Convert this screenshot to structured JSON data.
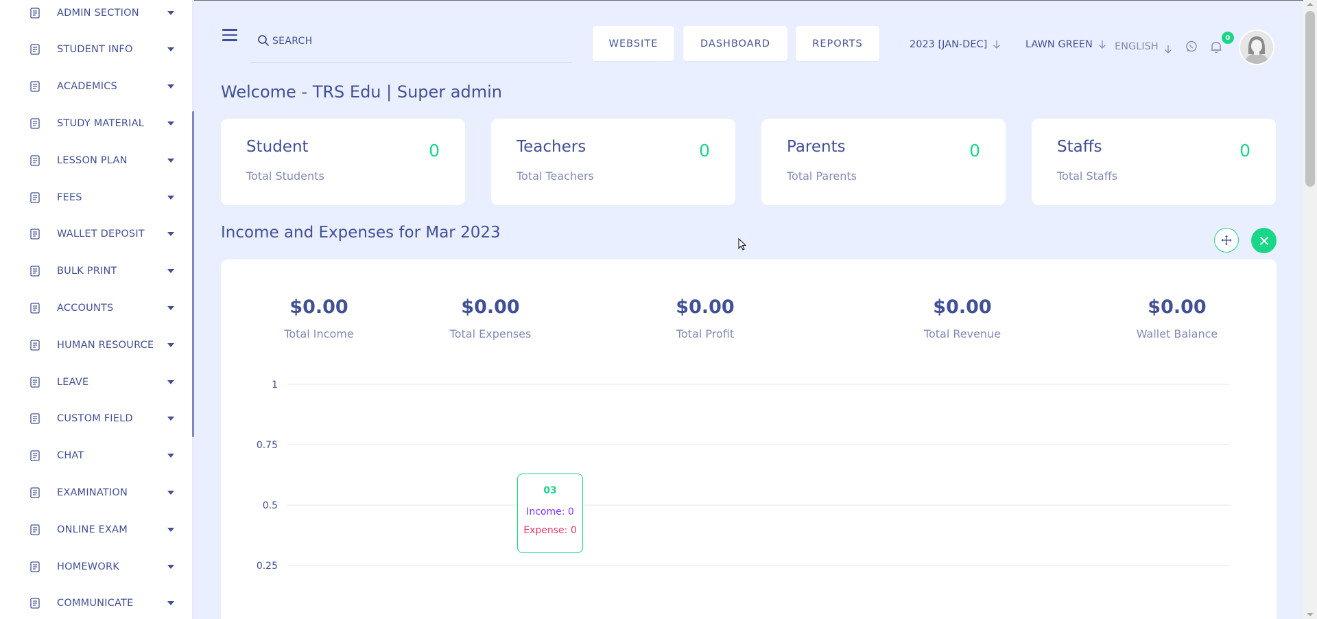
{
  "sidebar": {
    "items": [
      {
        "label": "ADMIN SECTION",
        "icon": "admin-icon"
      },
      {
        "label": "STUDENT INFO",
        "icon": "student-icon"
      },
      {
        "label": "ACADEMICS",
        "icon": "academics-icon"
      },
      {
        "label": "STUDY MATERIAL",
        "icon": "study-material-icon"
      },
      {
        "label": "LESSON PLAN",
        "icon": "lesson-plan-icon"
      },
      {
        "label": "FEES",
        "icon": "fees-icon"
      },
      {
        "label": "WALLET DEPOSIT",
        "icon": "wallet-icon"
      },
      {
        "label": "BULK PRINT",
        "icon": "bulk-print-icon"
      },
      {
        "label": "ACCOUNTS",
        "icon": "accounts-icon"
      },
      {
        "label": "HUMAN RESOURCE",
        "icon": "human-resource-icon"
      },
      {
        "label": "LEAVE",
        "icon": "leave-icon"
      },
      {
        "label": "CUSTOM FIELD",
        "icon": "custom-field-icon"
      },
      {
        "label": "CHAT",
        "icon": "chat-icon"
      },
      {
        "label": "EXAMINATION",
        "icon": "examination-icon"
      },
      {
        "label": "ONLINE EXAM",
        "icon": "online-exam-icon"
      },
      {
        "label": "HOMEWORK",
        "icon": "homework-icon"
      },
      {
        "label": "COMMUNICATE",
        "icon": "communicate-icon"
      }
    ]
  },
  "header": {
    "search_placeholder": "SEARCH",
    "buttons": {
      "website": "WEBSITE",
      "dashboard": "DASHBOARD",
      "reports": "REPORTS"
    },
    "academic_year": "2023 [JAN-DEC]",
    "theme": "LAWN GREEN",
    "language": "ENGLISH",
    "notification_count": "0"
  },
  "welcome": "Welcome - TRS Edu | Super admin",
  "stats": [
    {
      "title": "Student",
      "subtitle": "Total Students",
      "value": "0"
    },
    {
      "title": "Teachers",
      "subtitle": "Total Teachers",
      "value": "0"
    },
    {
      "title": "Parents",
      "subtitle": "Total Parents",
      "value": "0"
    },
    {
      "title": "Staffs",
      "subtitle": "Total Staffs",
      "value": "0"
    }
  ],
  "income_section": {
    "title": "Income and Expenses for Mar 2023",
    "summary": [
      {
        "value": "$0.00",
        "label": "Total Income"
      },
      {
        "value": "$0.00",
        "label": "Total Expenses"
      },
      {
        "value": "$0.00",
        "label": "Total Profit"
      },
      {
        "value": "$0.00",
        "label": "Total Revenue"
      },
      {
        "value": "$0.00",
        "label": "Wallet Balance"
      }
    ],
    "tooltip": {
      "label": "03",
      "income": "Income: 0",
      "expense": "Expense: 0"
    }
  },
  "colors": {
    "primary": "#415094",
    "accent": "#1ad788",
    "income": "#7c32ff",
    "expense": "#ea3566",
    "background": "#eaefff"
  },
  "chart_data": {
    "type": "line",
    "yticks": [
      "1",
      "0.75",
      "0.5",
      "0.25"
    ],
    "ylim": [
      0,
      1
    ],
    "series": [
      {
        "name": "Income",
        "values": [
          0
        ]
      },
      {
        "name": "Expense",
        "values": [
          0
        ]
      }
    ],
    "x": [
      "03"
    ],
    "grid": true
  }
}
